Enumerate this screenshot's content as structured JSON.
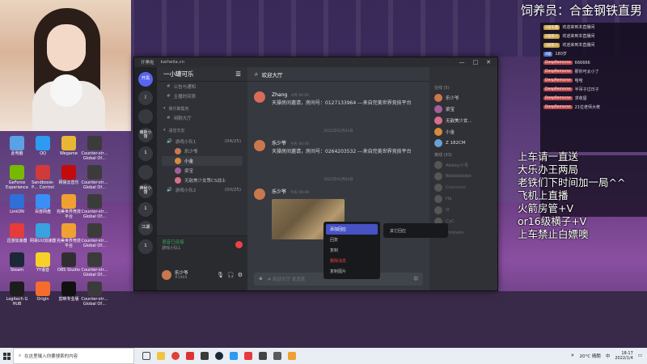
{
  "overlay": {
    "title": "饲养员：合金钢铁直男"
  },
  "desktop": {
    "icons": [
      {
        "label": "此电脑",
        "color": "#5aa2e6"
      },
      {
        "label": "QQ",
        "color": "#2d9bf0"
      },
      {
        "label": "Wegame",
        "color": "#e8b835"
      },
      {
        "label": "Counter-str… Global Of…",
        "color": "#3b3b3b"
      },
      {
        "label": "GeForce Experience",
        "color": "#76b900"
      },
      {
        "label": "Sandboxie-P… Control",
        "color": "#d13a3a"
      },
      {
        "label": "网易云音乐",
        "color": "#c20c0c"
      },
      {
        "label": "Counter-str… Global Of…",
        "color": "#3b3b3b"
      },
      {
        "label": "LinkDN",
        "color": "#2e6fd8"
      },
      {
        "label": "百度网盘",
        "color": "#3a8ef6"
      },
      {
        "label": "完美世界竞技平台",
        "color": "#f0a030"
      },
      {
        "label": "Counter-str… Global Of…",
        "color": "#3b3b3b"
      },
      {
        "label": "迅游加速器",
        "color": "#e63b3b"
      },
      {
        "label": "网易UU加速器",
        "color": "#3aa1e0"
      },
      {
        "label": "完美世界竞技平台",
        "color": "#f0a030"
      },
      {
        "label": "Counter-str… Global Of…",
        "color": "#3b3b3b"
      },
      {
        "label": "Steam",
        "color": "#1b2838"
      },
      {
        "label": "YY语音",
        "color": "#f6d12a"
      },
      {
        "label": "OBS Studio",
        "color": "#302e31"
      },
      {
        "label": "Counter-str… Global Of…",
        "color": "#3b3b3b"
      },
      {
        "label": "Logitech G HUB",
        "color": "#1d1d1d"
      },
      {
        "label": "Origin",
        "color": "#f56c2d"
      },
      {
        "label": "剪映专业版",
        "color": "#111111"
      },
      {
        "label": "Counter-str… Global Of…",
        "color": "#3b3b3b"
      }
    ]
  },
  "browser": {
    "tab_label": "开黑啦",
    "url": "kaiheila.cn",
    "window_controls": [
      "—",
      "□",
      "✕"
    ]
  },
  "guilds": [
    {
      "label": "开黑"
    },
    {
      "label": "j"
    },
    {
      "label": ""
    },
    {
      "label": "萌新小馆"
    },
    {
      "label": "1"
    },
    {
      "label": ""
    },
    {
      "label": "神秘小馆"
    },
    {
      "label": "1"
    },
    {
      "label": "江湖"
    },
    {
      "label": "1"
    }
  ],
  "server": {
    "name": "一小罐可乐",
    "channels": [
      {
        "label": "公告与通知",
        "type": "text"
      },
      {
        "label": "主播时间表",
        "type": "text"
      },
      {
        "label": "娱乐聚集地",
        "type": "cat"
      },
      {
        "label": "闲聊大厅",
        "type": "text"
      },
      {
        "label": "语音交友",
        "type": "cat"
      }
    ],
    "voice_channel_1": {
      "label": "游戏小队1",
      "count": "(04/25)"
    },
    "voice_users": [
      {
        "name": "乐少爷",
        "color": "#c9784e"
      },
      {
        "name": "小金",
        "color": "#d98a3a",
        "active": true
      },
      {
        "name": "梁宝",
        "color": "#a65d9c"
      },
      {
        "name": "无敌美少女策CS战士",
        "color": "#d96f8a"
      }
    ],
    "voice_channel_2": {
      "label": "游戏小队2",
      "count": "(00/25)"
    },
    "voice_status": "语音已连接",
    "voice_sub": "游戏小队1",
    "user": {
      "name": "乐少爷",
      "tag": "#1404"
    }
  },
  "chat": {
    "channel": "欢迎大厅",
    "help": "帮助中心",
    "messages": [
      {
        "name": "Zhang",
        "time": "4月 00:00",
        "text": "天操房间邀请，房间号：0127133964 ---来自完美世界竞技平台"
      },
      {
        "name": "乐少爷",
        "time": "今天 00:00",
        "text": "天操房间邀请，房间号：0264203532 ---来自完美世界竞技平台"
      },
      {
        "name": "乐少爷",
        "time": "今天 00:00",
        "text": ""
      }
    ],
    "dividers": [
      "2022年01月02日",
      "2022年01月04日"
    ],
    "compose_placeholder": "# 欢迎大厅 发消息"
  },
  "members": {
    "online_label": "在线 (5)",
    "online": [
      {
        "name": "乐少爷",
        "color": "#c9784e"
      },
      {
        "name": "梁宝",
        "color": "#a65d9c"
      },
      {
        "name": "无敌美少女…",
        "color": "#d96f8a"
      },
      {
        "name": "小金",
        "color": "#d98a3a"
      },
      {
        "name": "Z 182CM",
        "color": "#6aa0d8",
        "sub": "正在玩 绝地求生"
      }
    ],
    "offline_label": "离线 (33)",
    "offline": [
      {
        "name": "Abbey小冬"
      },
      {
        "name": "Bbbbbbbbb"
      },
      {
        "name": "Cccccccc"
      },
      {
        "name": "Ha"
      },
      {
        "name": "lll"
      },
      {
        "name": "CyC"
      },
      {
        "name": "Eminem"
      }
    ]
  },
  "context_menu": {
    "items": [
      "添加回应",
      "回复",
      "复制",
      "删除消息",
      "复制图片"
    ],
    "submenu": "其它回应"
  },
  "right_overlay": {
    "rows": [
      {
        "badge": "1级乐鑫",
        "text": "欢迎来到本直播间"
      },
      {
        "badge": "2级新人",
        "text": "欢迎来到本直播间"
      },
      {
        "badge": "3级新人",
        "text": "欢迎来到本直播间"
      },
      {
        "badge": "4级",
        "text": "180岁"
      },
      {
        "badge": "DeepRemorse",
        "text": "666666"
      },
      {
        "badge": "DeepRemorse",
        "text": "那你可太小了"
      },
      {
        "badge": "DeepRemorse",
        "text": "哈哈"
      },
      {
        "badge": "DeepRemorse",
        "text": "半吊子过日子"
      },
      {
        "badge": "DeepRemorse",
        "text": "求收留"
      },
      {
        "badge": "DeepRemorse",
        "text": "21位老师大佬"
      }
    ]
  },
  "danmaku": [
    "上车请一直送",
    "大乐办王两局",
    "老铁们下时间加一局^^",
    "飞机上直播",
    "火箭房管+V",
    "or16级横子+V",
    "上车禁止白嫖噢"
  ],
  "taskbar": {
    "search_placeholder": "在这里输入你要搜索的内容",
    "weather": "20°C 晴朗",
    "time": "18:17",
    "date": "2022/1/4",
    "lang": "中"
  }
}
